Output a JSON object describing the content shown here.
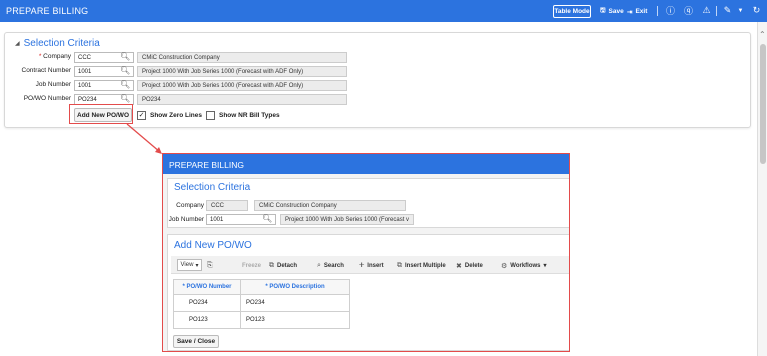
{
  "header": {
    "title": "PREPARE BILLING",
    "table_mode": "Table Mode",
    "save": "Save",
    "exit": "Exit"
  },
  "selection": {
    "title": "Selection Criteria",
    "fields": [
      {
        "label": "Company",
        "required": true,
        "value": "CCC",
        "description": "CMiC Construction Company"
      },
      {
        "label": "Contract Number",
        "required": false,
        "value": "1001",
        "description": "Project 1000 With Job Series 1000 (Forecast with ADF Only)"
      },
      {
        "label": "Job Number",
        "required": false,
        "value": "1001",
        "description": "Project 1000 With Job Series 1000 (Forecast with ADF Only)"
      },
      {
        "label": "PO/WO Number",
        "required": false,
        "value": "PO234",
        "description": "PO234"
      }
    ],
    "add_button": "Add New PO/WO",
    "show_zero_lines": "Show Zero Lines",
    "show_zero_checked": true,
    "show_nr": "Show NR Bill Types",
    "show_nr_checked": false
  },
  "inset": {
    "title": "PREPARE BILLING",
    "selection_title": "Selection Criteria",
    "company_label": "Company",
    "company_value": "CCC",
    "company_desc": "CMiC Construction Company",
    "job_label": "Job Number",
    "job_value": "1001",
    "job_desc": "Project 1000 With Job Series 1000 (Forecast v",
    "addnew_title": "Add New PO/WO",
    "toolbar": {
      "view": "View",
      "freeze": "Freeze",
      "detach": "Detach",
      "search": "Search",
      "insert": "Insert",
      "insert_multiple": "Insert Multiple",
      "delete": "Delete",
      "workflows": "Workflows"
    },
    "grid": {
      "col1": "* PO/WO Number",
      "col2": "* PO/WO Description",
      "rows": [
        {
          "number": "PO234",
          "description": "PO234"
        },
        {
          "number": "PO123",
          "description": "PO123"
        }
      ]
    },
    "save_close": "Save / Close"
  },
  "colors": {
    "brand_blue": "#2c73df",
    "highlight_red": "#e34b4b"
  }
}
